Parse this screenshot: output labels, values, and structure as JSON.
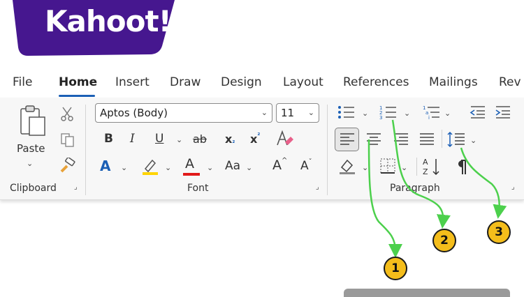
{
  "logo": {
    "text": "Kahoot!",
    "color": "#46178f"
  },
  "tabs": [
    {
      "label": "File"
    },
    {
      "label": "Home",
      "active": true
    },
    {
      "label": "Insert"
    },
    {
      "label": "Draw"
    },
    {
      "label": "Design"
    },
    {
      "label": "Layout"
    },
    {
      "label": "References"
    },
    {
      "label": "Mailings"
    },
    {
      "label": "Rev"
    }
  ],
  "clipboard": {
    "paste_label": "Paste",
    "group_label": "Clipboard"
  },
  "font": {
    "font_name": "Aptos (Body)",
    "font_size": "11",
    "bold": "B",
    "italic": "I",
    "underline": "U",
    "strikethrough": "ab",
    "subscript": "x",
    "superscript": "x",
    "change_case": "Aa",
    "grow_font": "A",
    "shrink_font": "A",
    "text_effects": "A",
    "font_color": "A",
    "group_label": "Font"
  },
  "paragraph": {
    "group_label": "Paragraph"
  },
  "annotations": [
    {
      "number": "1"
    },
    {
      "number": "2"
    },
    {
      "number": "3"
    }
  ],
  "colors": {
    "accent": "#1b5fb5",
    "highlight": "#ffd400",
    "font_color": "#e11a1a",
    "arrow": "#4cd04c",
    "badge": "#f4bd1b"
  }
}
